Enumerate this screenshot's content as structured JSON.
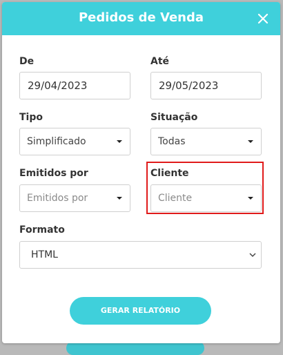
{
  "modal": {
    "title": "Pedidos de Venda",
    "close_icon": "close-icon"
  },
  "form": {
    "de": {
      "label": "De",
      "value": "29/04/2023"
    },
    "ate": {
      "label": "Até",
      "value": "29/05/2023"
    },
    "tipo": {
      "label": "Tipo",
      "selected": "Simplificado"
    },
    "situacao": {
      "label": "Situação",
      "selected": "Todas"
    },
    "emitidos_por": {
      "label": "Emitidos por",
      "placeholder": "Emitidos por"
    },
    "cliente": {
      "label": "Cliente",
      "placeholder": "Cliente"
    },
    "formato": {
      "label": "Formato",
      "selected": "HTML"
    }
  },
  "actions": {
    "generate_label": "GERAR RELATÓRIO"
  },
  "colors": {
    "accent": "#3fd0db",
    "highlight": "#e01a1a"
  }
}
